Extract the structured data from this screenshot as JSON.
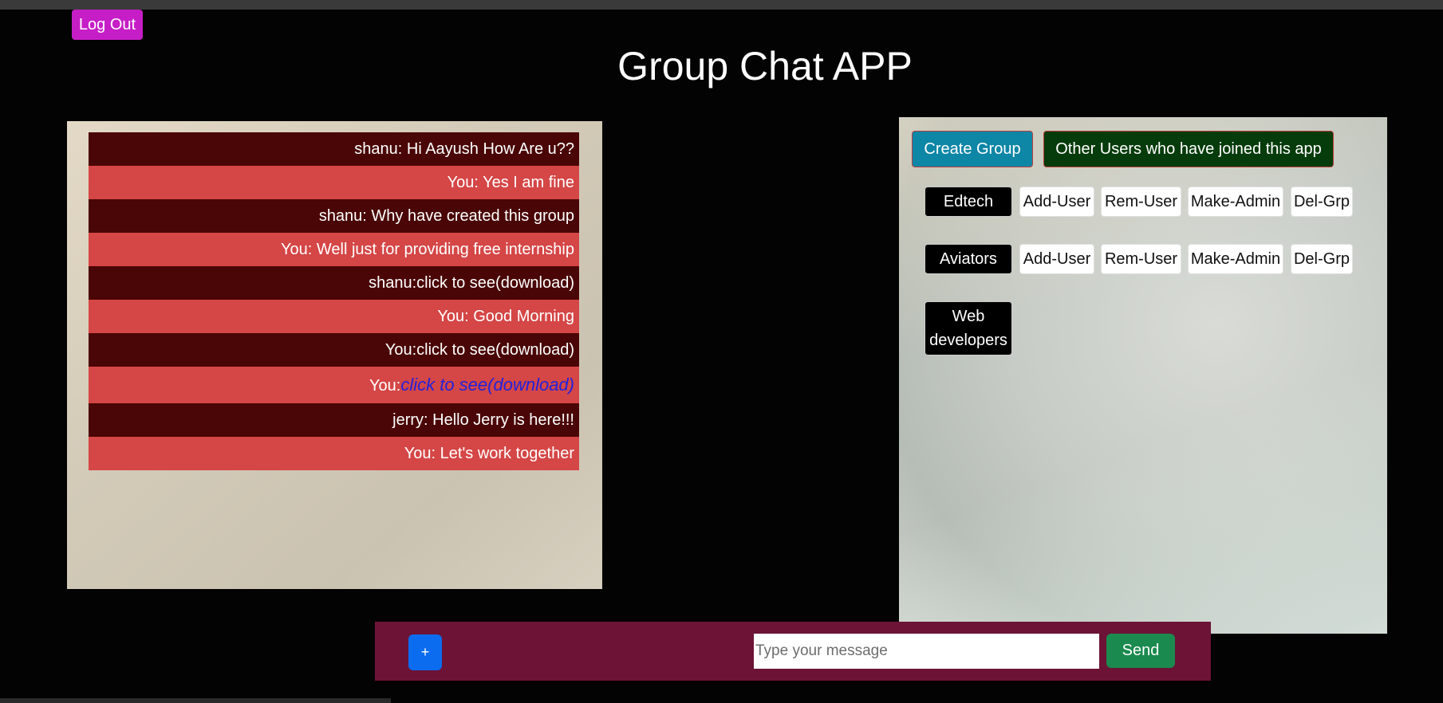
{
  "header": {
    "logout_label": "Log Out",
    "title": "Group Chat APP"
  },
  "chat": {
    "messages": [
      {
        "text": "shanu: Hi Aayush How Are u??",
        "style": "dark"
      },
      {
        "text": "You: Yes I am fine",
        "style": "light"
      },
      {
        "text": "shanu: Why have created this group",
        "style": "dark"
      },
      {
        "text": "You: Well just for providing free internship",
        "style": "light"
      },
      {
        "text": "shanu:click to see(download)",
        "style": "dark"
      },
      {
        "text": "You: Good Morning",
        "style": "light"
      },
      {
        "text": "You:click to see(download)",
        "style": "dark"
      },
      {
        "prefix": "You:",
        "link_text": "click to see(download)",
        "style": "light"
      },
      {
        "text": "jerry: Hello Jerry is here!!!",
        "style": "dark"
      },
      {
        "text": "You: Let's work together",
        "style": "light"
      }
    ]
  },
  "groups_panel": {
    "create_group_label": "Create Group",
    "other_users_label": "Other Users who have joined this app",
    "groups": [
      {
        "name": "Edtech",
        "actions": [
          "Add-User",
          "Rem-User",
          "Make-Admin",
          "Del-Grp"
        ]
      },
      {
        "name": "Aviators",
        "actions": [
          "Add-User",
          "Rem-User",
          "Make-Admin",
          "Del-Grp"
        ]
      },
      {
        "name": "Web developers",
        "actions": []
      }
    ]
  },
  "composer": {
    "attach_label": "+",
    "input_placeholder": "Type your message",
    "input_value": "",
    "send_label": "Send"
  },
  "colors": {
    "logout": "#c61ec6",
    "message_dark": "#4a0506",
    "message_light": "#d54646",
    "link": "#2222dd",
    "create_group": "#0e86a6",
    "other_users": "#063c0b",
    "composer_bar": "#6c1336",
    "attach_button": "#0c6cf0",
    "send_button": "#1b8a4f"
  }
}
